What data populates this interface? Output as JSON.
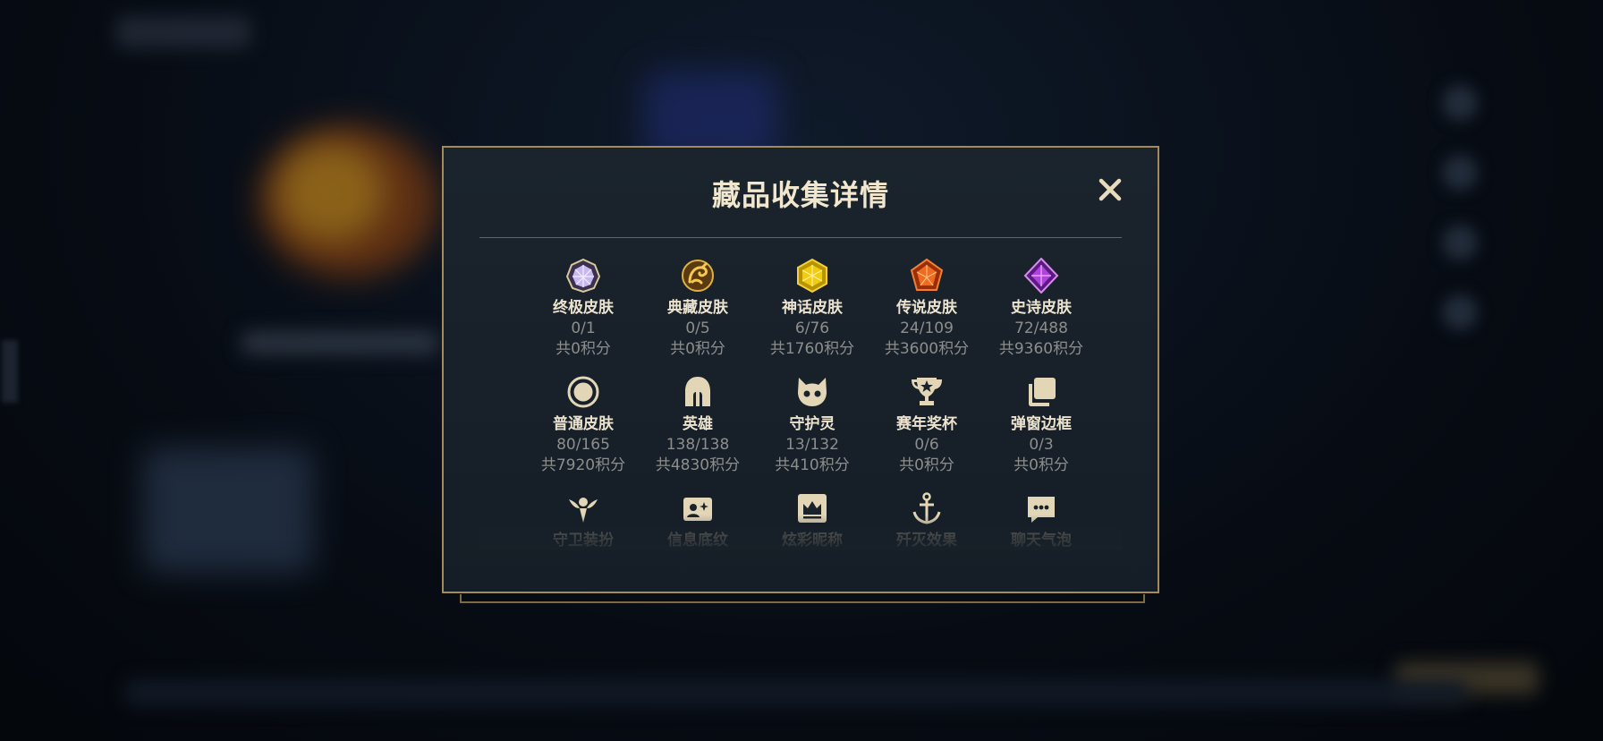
{
  "modal": {
    "title": "藏品收集详情",
    "close_icon": "close-icon"
  },
  "colors": {
    "gold": "#c9b48a",
    "title": "#f1e7cf",
    "border": "#a28a5a",
    "count_text": "#8d8e8c"
  },
  "categories": [
    {
      "name": "终极皮肤",
      "count": "0/1",
      "points": "共0积分",
      "icon": "ultimate-skin-icon"
    },
    {
      "name": "典藏皮肤",
      "count": "0/5",
      "points": "共0积分",
      "icon": "collection-skin-icon"
    },
    {
      "name": "神话皮肤",
      "count": "6/76",
      "points": "共1760积分",
      "icon": "mythic-skin-icon"
    },
    {
      "name": "传说皮肤",
      "count": "24/109",
      "points": "共3600积分",
      "icon": "legendary-skin-icon"
    },
    {
      "name": "史诗皮肤",
      "count": "72/488",
      "points": "共9360积分",
      "icon": "epic-skin-icon"
    },
    {
      "name": "普通皮肤",
      "count": "80/165",
      "points": "共7920积分",
      "icon": "normal-skin-icon"
    },
    {
      "name": "英雄",
      "count": "138/138",
      "points": "共4830积分",
      "icon": "hero-helmet-icon"
    },
    {
      "name": "守护灵",
      "count": "13/132",
      "points": "共410积分",
      "icon": "guardian-spirit-icon"
    },
    {
      "name": "赛年奖杯",
      "count": "0/6",
      "points": "共0积分",
      "icon": "trophy-icon"
    },
    {
      "name": "弹窗边框",
      "count": "0/3",
      "points": "共0积分",
      "icon": "popup-frame-icon"
    },
    {
      "name": "守卫装扮",
      "icon": "ward-skin-icon"
    },
    {
      "name": "信息底纹",
      "icon": "info-card-icon"
    },
    {
      "name": "炫彩昵称",
      "icon": "colorful-name-icon"
    },
    {
      "name": "歼灭效果",
      "icon": "kill-effect-icon"
    },
    {
      "name": "聊天气泡",
      "icon": "chat-bubble-icon"
    }
  ]
}
